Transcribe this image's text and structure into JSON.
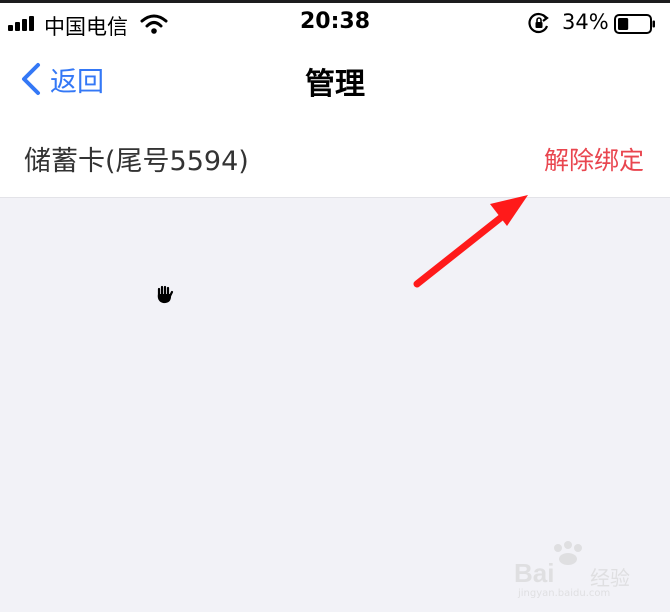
{
  "status_bar": {
    "carrier": "中国电信",
    "time": "20:38",
    "battery_percent": "34%",
    "battery_level": 0.34,
    "signal_bars": 4,
    "icons": [
      "signal-icon",
      "wifi-icon",
      "orientation-lock-icon",
      "battery-icon"
    ]
  },
  "nav": {
    "back_label": "返回",
    "title": "管理",
    "accent_color": "#3478f6"
  },
  "card": {
    "name": "储蓄卡(尾号5594)",
    "action_label": "解除绑定",
    "action_color": "#e9464f"
  },
  "annotation": {
    "arrow_color": "#ff1a1a"
  },
  "watermark": {
    "brand": "Bai",
    "brand_cn": "经验",
    "url": "jingyan.baidu.com"
  }
}
